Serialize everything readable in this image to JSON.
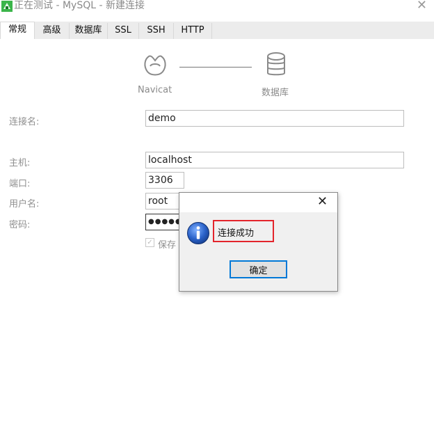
{
  "window": {
    "title": "正在测试 - MySQL - 新建连接",
    "close_glyph": "✕"
  },
  "tabs": [
    {
      "label": "常规",
      "active": true
    },
    {
      "label": "高级",
      "active": false
    },
    {
      "label": "数据库",
      "active": false
    },
    {
      "label": "SSL",
      "active": false
    },
    {
      "label": "SSH",
      "active": false
    },
    {
      "label": "HTTP",
      "active": false
    }
  ],
  "diagram": {
    "left_label": "Navicat",
    "right_label": "数据库"
  },
  "form": {
    "connection_name": {
      "label": "连接名:",
      "value": "demo"
    },
    "host": {
      "label": "主机:",
      "value": "localhost"
    },
    "port": {
      "label": "端口:",
      "value": "3306"
    },
    "username": {
      "label": "用户名:",
      "value": "root"
    },
    "password": {
      "label": "密码:",
      "value": "●●●●●"
    },
    "save_password": {
      "label": "保存",
      "checked": true
    }
  },
  "dialog": {
    "close_glyph": "✕",
    "message": "连接成功",
    "ok_label": "确定",
    "icon": "info-icon"
  },
  "colors": {
    "accent": "#0078d7",
    "highlight": "#e3242b",
    "info_blue": "#1f5fbf",
    "app_icon_green": "#3bb54a"
  }
}
